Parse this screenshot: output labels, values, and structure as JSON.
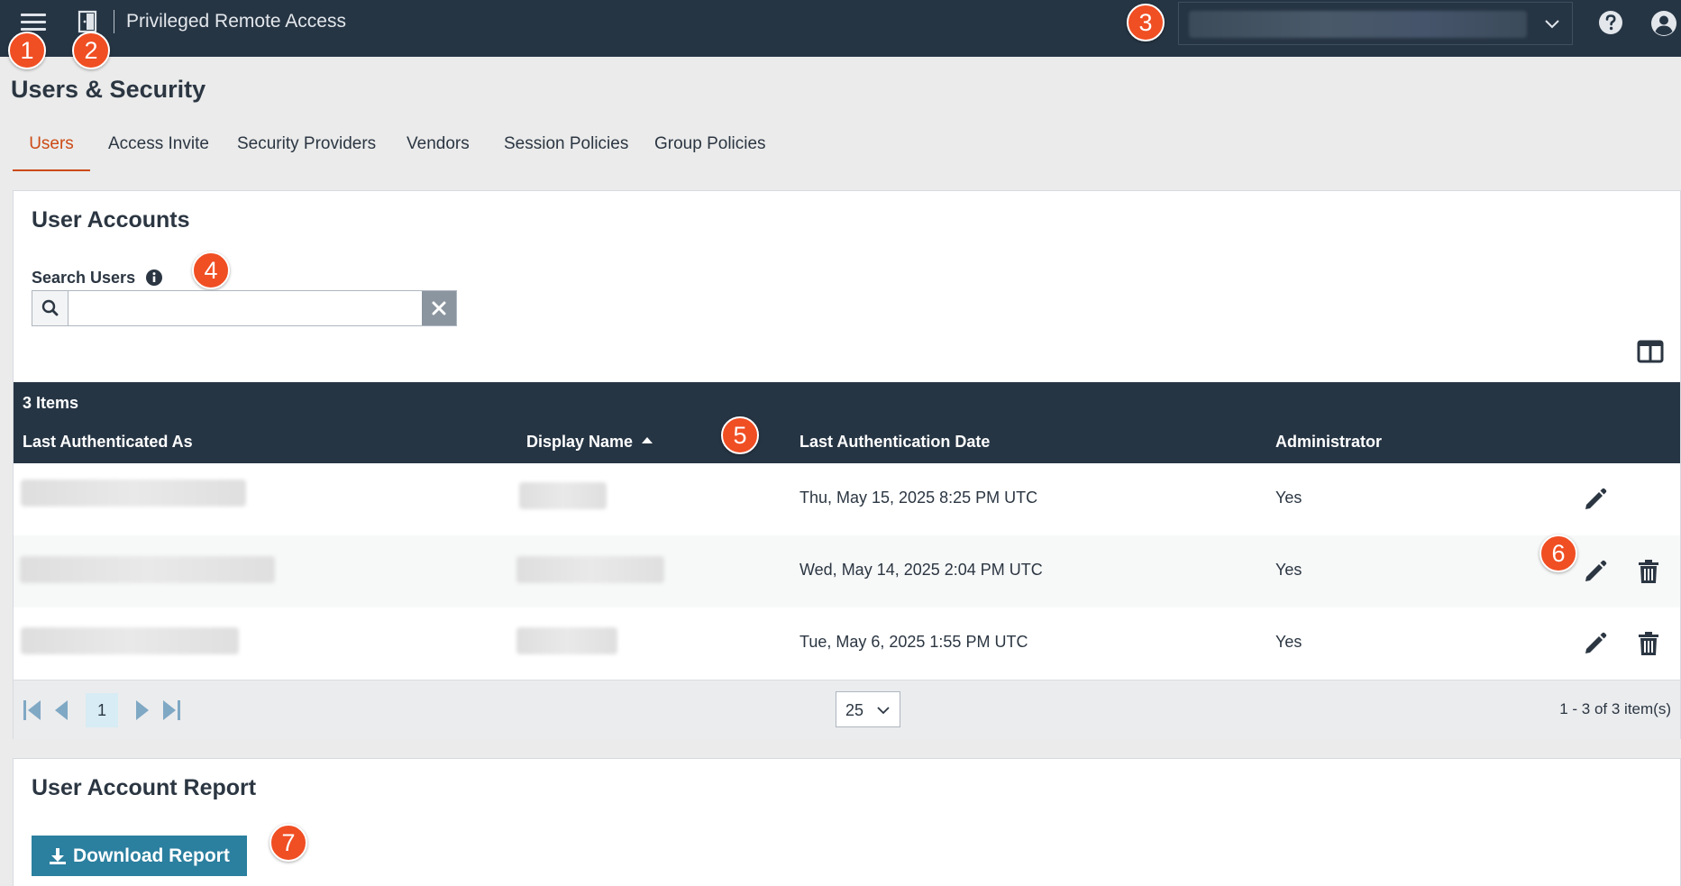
{
  "header": {
    "app_title": "Privileged Remote Access"
  },
  "page": {
    "title": "Users & Security"
  },
  "tabs": [
    {
      "label": "Users",
      "active": true
    },
    {
      "label": "Access Invite"
    },
    {
      "label": "Security Providers"
    },
    {
      "label": "Vendors"
    },
    {
      "label": "Session Policies"
    },
    {
      "label": "Group Policies"
    }
  ],
  "user_accounts": {
    "title": "User Accounts",
    "search_label": "Search Users",
    "search_value": "",
    "items_count": "3 Items",
    "columns": [
      "Last Authenticated As",
      "Display Name",
      "Last Authentication Date",
      "Administrator"
    ],
    "sort_column": "Display Name",
    "sort_direction": "ascending",
    "rows": [
      {
        "date": "Thu, May 15, 2025 8:25 PM UTC",
        "admin": "Yes"
      },
      {
        "date": "Wed, May 14, 2025 2:04 PM UTC",
        "admin": "Yes"
      },
      {
        "date": "Tue, May 6, 2025 1:55 PM UTC",
        "admin": "Yes"
      }
    ],
    "pager": {
      "current_page": "1",
      "page_size": "25",
      "info": "1 - 3 of 3 item(s)"
    }
  },
  "report": {
    "title": "User Account Report",
    "download_label": "Download Report"
  },
  "callouts": [
    "1",
    "2",
    "3",
    "4",
    "5",
    "6",
    "7"
  ],
  "colors": {
    "topbar": "#263544",
    "accent": "#cc4a14",
    "callout": "#f04e23",
    "button": "#2b7f9f"
  },
  "icons": [
    "menu-icon",
    "door-icon",
    "chevron-down-icon",
    "help-icon",
    "user-icon",
    "info-icon",
    "search-icon",
    "close-icon",
    "columns-icon",
    "edit-icon",
    "trash-icon",
    "first-page-icon",
    "prev-page-icon",
    "next-page-icon",
    "last-page-icon",
    "download-icon"
  ]
}
